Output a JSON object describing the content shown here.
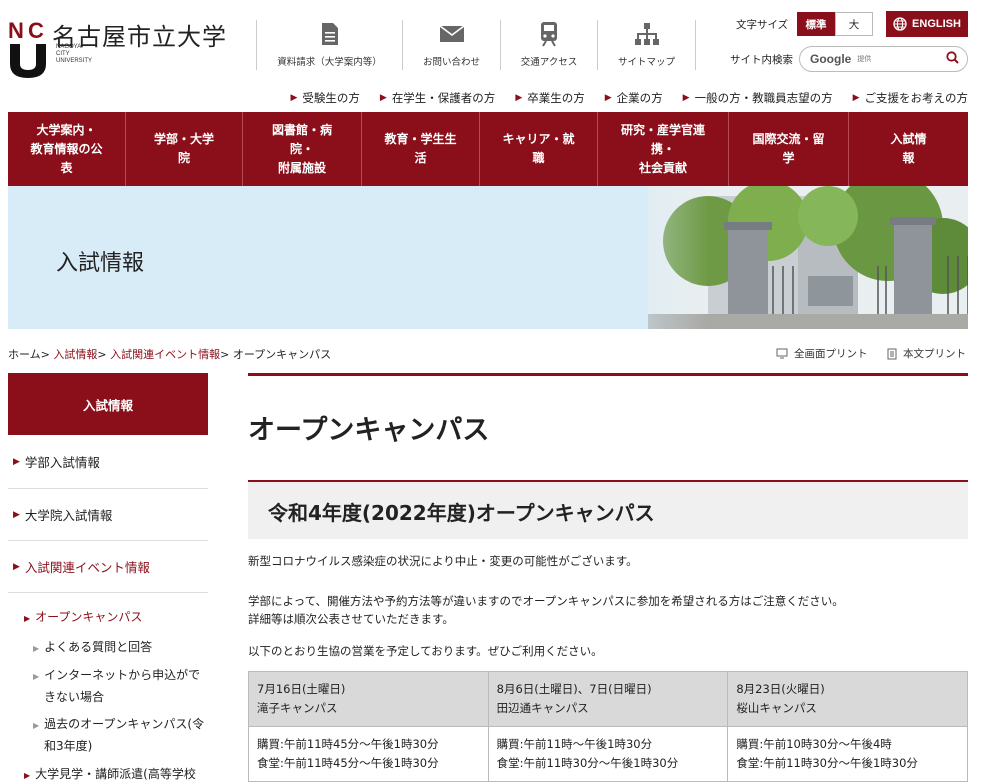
{
  "header": {
    "logo_initials": "NCU",
    "logo_ja": "名古屋市立大学",
    "logo_en": [
      "NAGOYA",
      "CITY",
      "UNIVERSITY"
    ],
    "utility": [
      {
        "label": "資料請求（大学案内等）",
        "icon": "document-icon"
      },
      {
        "label": "お問い合わせ",
        "icon": "mail-icon"
      },
      {
        "label": "交通アクセス",
        "icon": "train-icon"
      },
      {
        "label": "サイトマップ",
        "icon": "sitemap-icon"
      }
    ],
    "font_size_label": "文字サイズ",
    "font_std": "標準",
    "font_big": "大",
    "english": "ENGLISH",
    "search_label": "サイト内検索",
    "search_google": "Google",
    "search_provided": "提供"
  },
  "audience": [
    "受験生の方",
    "在学生・保護者の方",
    "卒業生の方",
    "企業の方",
    "一般の方・教職員志望の方",
    "ご支援をお考えの方"
  ],
  "mainnav": [
    {
      "lines": [
        "大学案内・",
        "教育情報の公",
        "表"
      ]
    },
    {
      "lines": [
        "学部・大学",
        "院"
      ]
    },
    {
      "lines": [
        "図書館・病",
        "院・",
        "附属施設"
      ]
    },
    {
      "lines": [
        "教育・学生生",
        "活"
      ]
    },
    {
      "lines": [
        "キャリア・就",
        "職"
      ]
    },
    {
      "lines": [
        "研究・産学官連",
        "携・",
        "社会貢献"
      ]
    },
    {
      "lines": [
        "国際交流・留",
        "学"
      ]
    },
    {
      "lines": [
        "入試情",
        "報"
      ]
    }
  ],
  "hero_title": "入試情報",
  "breadcrumb": {
    "home": "ホーム",
    "c1": "入試情報",
    "c2": "入試関連イベント情報",
    "current": "オープンキャンパス",
    "sep": ">"
  },
  "print": {
    "full": "全画面プリント",
    "text": "本文プリント"
  },
  "sidebar": {
    "head": "入試情報",
    "items": [
      "学部入試情報",
      "大学院入試情報",
      "入試関連イベント情報"
    ],
    "sub_active": "オープンキャンパス",
    "sub_items": [
      "よくある質問と回答",
      "インターネットから申込ができない場合",
      "過去のオープンキャンパス(令和3年度)"
    ],
    "sub_items_lines": [
      [
        "よくある質問と回答"
      ],
      [
        "インターネットから申込がで",
        "きない場合"
      ],
      [
        "過去のオープンキャンパス(令",
        "和3年度)"
      ]
    ],
    "next_item": "大学見学・講師派遣(高等学校"
  },
  "main": {
    "title": "オープンキャンパス",
    "section_title": "令和4年度(2022年度)オープンキャンパス",
    "p1": "新型コロナウイルス感染症の状況により中止・変更の可能性がございます。",
    "p2": "学部によって、開催方法や予約方法等が違いますのでオープンキャンパスに参加を希望される方はご注意ください。",
    "p3": "詳細等は順次公表させていただきます。",
    "p4": "以下のとおり生協の営業を予定しております。ぜひご利用ください。"
  },
  "schedule": {
    "columns": [
      {
        "date": "7月16日(土曜日)",
        "campus": "滝子キャンパス",
        "shop": "購買:午前11時45分～午後1時30分",
        "cafe": "食堂:午前11時45分～午後1時30分"
      },
      {
        "date": "8月6日(土曜日)、7日(日曜日)",
        "campus": "田辺通キャンパス",
        "shop": "購買:午前11時～午後1時30分",
        "cafe": "食堂:午前11時30分～午後1時30分"
      },
      {
        "date": "8月23日(火曜日)",
        "campus": "桜山キャンパス",
        "shop": "購買:午前10時30分～午後4時",
        "cafe": "食堂:午前11時30分～午後1時30分"
      }
    ]
  },
  "colors": {
    "brand": "#8a0f1a",
    "hero_bg": "#d8ecf8"
  }
}
